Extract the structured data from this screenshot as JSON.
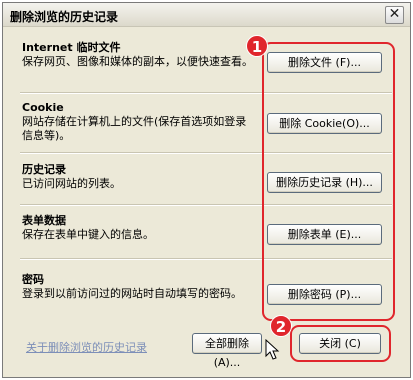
{
  "window": {
    "title": "删除浏览的历史记录",
    "close_glyph": "✕"
  },
  "sections": [
    {
      "title": "Internet 临时文件",
      "desc": "保存网页、图像和媒体的副本，以便快速查看。",
      "button": "删除文件 (F)..."
    },
    {
      "title": "Cookie",
      "desc": "网站存储在计算机上的文件(保存首选项如登录信息等)。",
      "button": "删除 Cookie(O)..."
    },
    {
      "title": "历史记录",
      "desc": "已访问网站的列表。",
      "button": "删除历史记录 (H)..."
    },
    {
      "title": "表单数据",
      "desc": "保存在表单中键入的信息。",
      "button": "删除表单 (E)..."
    },
    {
      "title": "密码",
      "desc": "登录到以前访问过的网站时自动填写的密码。",
      "button": "删除密码 (P)..."
    }
  ],
  "footer": {
    "link": "关于删除浏览的历史记录",
    "delete_all": "全部删除 (A)...",
    "close": "关闭 (C)"
  },
  "annotations": {
    "badge1": "1",
    "badge2": "2",
    "color": "#e0262c"
  }
}
